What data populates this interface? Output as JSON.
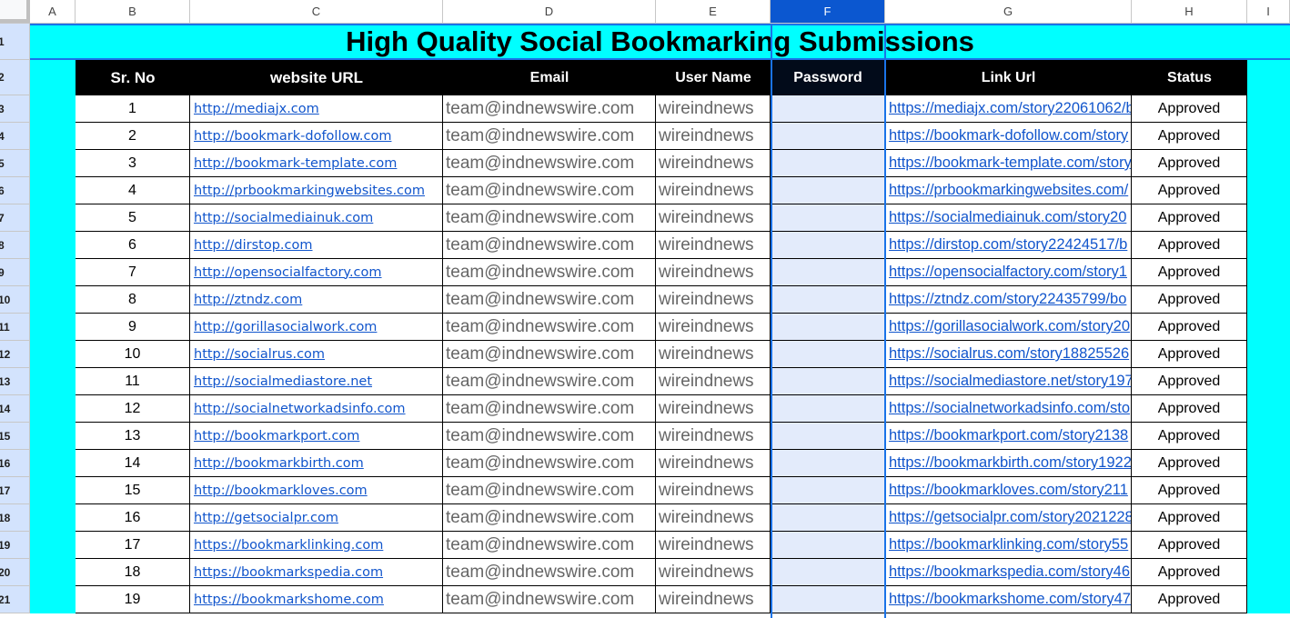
{
  "columns": [
    "A",
    "B",
    "C",
    "D",
    "E",
    "F",
    "G",
    "H",
    "I"
  ],
  "selected_column": "F",
  "title": "High Quality Social Bookmarking Submissions",
  "headers": {
    "sr": "Sr. No",
    "website": "website URL",
    "email": "Email",
    "user": "User Name",
    "password": "Password",
    "link": "Link Url",
    "status": "Status"
  },
  "row_numbers": [
    "1",
    "2"
  ],
  "rows": [
    {
      "rn": "3",
      "sr": "1",
      "website": "http://mediajx.com",
      "email": "team@indnewswire.com",
      "user": "wireindnews",
      "link": "https://mediajx.com/story22061062/b",
      "status": "Approved"
    },
    {
      "rn": "4",
      "sr": "2",
      "website": "http://bookmark-dofollow.com",
      "email": "team@indnewswire.com",
      "user": "wireindnews",
      "link": "https://bookmark-dofollow.com/story",
      "status": "Approved"
    },
    {
      "rn": "5",
      "sr": "3",
      "website": "http://bookmark-template.com",
      "email": "team@indnewswire.com",
      "user": "wireindnews",
      "link": "https://bookmark-template.com/story",
      "status": "Approved"
    },
    {
      "rn": "6",
      "sr": "4",
      "website": "http://prbookmarkingwebsites.com",
      "email": "team@indnewswire.com",
      "user": "wireindnews",
      "link": "https://prbookmarkingwebsites.com/",
      "status": "Approved"
    },
    {
      "rn": "7",
      "sr": "5",
      "website": "http://socialmediainuk.com",
      "email": "team@indnewswire.com",
      "user": "wireindnews",
      "link": "https://socialmediainuk.com/story20",
      "status": "Approved"
    },
    {
      "rn": "8",
      "sr": "6",
      "website": "http://dirstop.com",
      "email": "team@indnewswire.com",
      "user": "wireindnews",
      "link": "https://dirstop.com/story22424517/b",
      "status": "Approved"
    },
    {
      "rn": "9",
      "sr": "7",
      "website": "http://opensocialfactory.com",
      "email": "team@indnewswire.com",
      "user": "wireindnews",
      "link": "https://opensocialfactory.com/story1",
      "status": "Approved"
    },
    {
      "rn": "10",
      "sr": "8",
      "website": "http://ztndz.com",
      "email": "team@indnewswire.com",
      "user": "wireindnews",
      "link": "https://ztndz.com/story22435799/bo",
      "status": "Approved"
    },
    {
      "rn": "11",
      "sr": "9",
      "website": "http://gorillasocialwork.com",
      "email": "team@indnewswire.com",
      "user": "wireindnews",
      "link": "https://gorillasocialwork.com/story20",
      "status": "Approved"
    },
    {
      "rn": "12",
      "sr": "10",
      "website": "http://socialrus.com",
      "email": "team@indnewswire.com",
      "user": "wireindnews",
      "link": "https://socialrus.com/story18825526",
      "status": "Approved"
    },
    {
      "rn": "13",
      "sr": "11",
      "website": "http://socialmediastore.net",
      "email": "team@indnewswire.com",
      "user": "wireindnews",
      "link": "https://socialmediastore.net/story197",
      "status": "Approved"
    },
    {
      "rn": "14",
      "sr": "12",
      "website": "http://socialnetworkadsinfo.com",
      "email": "team@indnewswire.com",
      "user": "wireindnews",
      "link": "https://socialnetworkadsinfo.com/sto",
      "status": "Approved"
    },
    {
      "rn": "15",
      "sr": "13",
      "website": "http://bookmarkport.com",
      "email": "team@indnewswire.com",
      "user": "wireindnews",
      "link": "https://bookmarkport.com/story2138",
      "status": "Approved"
    },
    {
      "rn": "16",
      "sr": "14",
      "website": "http://bookmarkbirth.com",
      "email": "team@indnewswire.com",
      "user": "wireindnews",
      "link": "https://bookmarkbirth.com/story1922",
      "status": "Approved"
    },
    {
      "rn": "17",
      "sr": "15",
      "website": "http://bookmarkloves.com",
      "email": "team@indnewswire.com",
      "user": "wireindnews",
      "link": "https://bookmarkloves.com/story211",
      "status": "Approved"
    },
    {
      "rn": "18",
      "sr": "16",
      "website": "http://getsocialpr.com",
      "email": "team@indnewswire.com",
      "user": "wireindnews",
      "link": "https://getsocialpr.com/story2021228",
      "status": "Approved"
    },
    {
      "rn": "19",
      "sr": "17",
      "website": "https://bookmarklinking.com",
      "email": "team@indnewswire.com",
      "user": "wireindnews",
      "link": "https://bookmarklinking.com/story55",
      "status": "Approved"
    },
    {
      "rn": "20",
      "sr": "18",
      "website": "https://bookmarkspedia.com",
      "email": "team@indnewswire.com",
      "user": "wireindnews",
      "link": "https://bookmarkspedia.com/story46",
      "status": "Approved"
    },
    {
      "rn": "21",
      "sr": "19",
      "website": "https://bookmarkshome.com",
      "email": "team@indnewswire.com",
      "user": "wireindnews",
      "link": "https://bookmarkshome.com/story47",
      "status": "Approved"
    }
  ]
}
